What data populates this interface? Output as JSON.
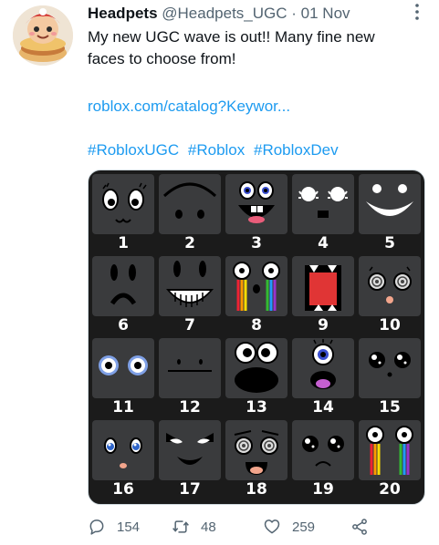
{
  "tweet": {
    "display_name": "Headpets",
    "handle": "@Headpets_UGC",
    "separator": "·",
    "date": "01 Nov",
    "text_line1": "My new UGC wave is out!! Many fine new",
    "text_line2": "faces to choose from!",
    "link": "roblox.com/catalog?Keywor...",
    "hashtags": [
      "#RobloxUGC",
      "#Roblox",
      "#RobloxDev"
    ]
  },
  "grid": {
    "numbers": [
      "1",
      "2",
      "3",
      "4",
      "5",
      "6",
      "7",
      "8",
      "9",
      "10",
      "11",
      "12",
      "13",
      "14",
      "15",
      "16",
      "17",
      "18",
      "19",
      "20"
    ]
  },
  "actions": {
    "replies": "154",
    "retweets": "48",
    "likes": "259"
  },
  "icons": {
    "reply": "reply-icon",
    "retweet": "retweet-icon",
    "like": "heart-icon",
    "share": "share-icon",
    "more": "more-dots-icon"
  },
  "colors": {
    "link": "#1d9bf0",
    "secondary_text": "#536471",
    "media_bg": "#1b1b1b",
    "tile_bg": "#3a3b3d"
  }
}
